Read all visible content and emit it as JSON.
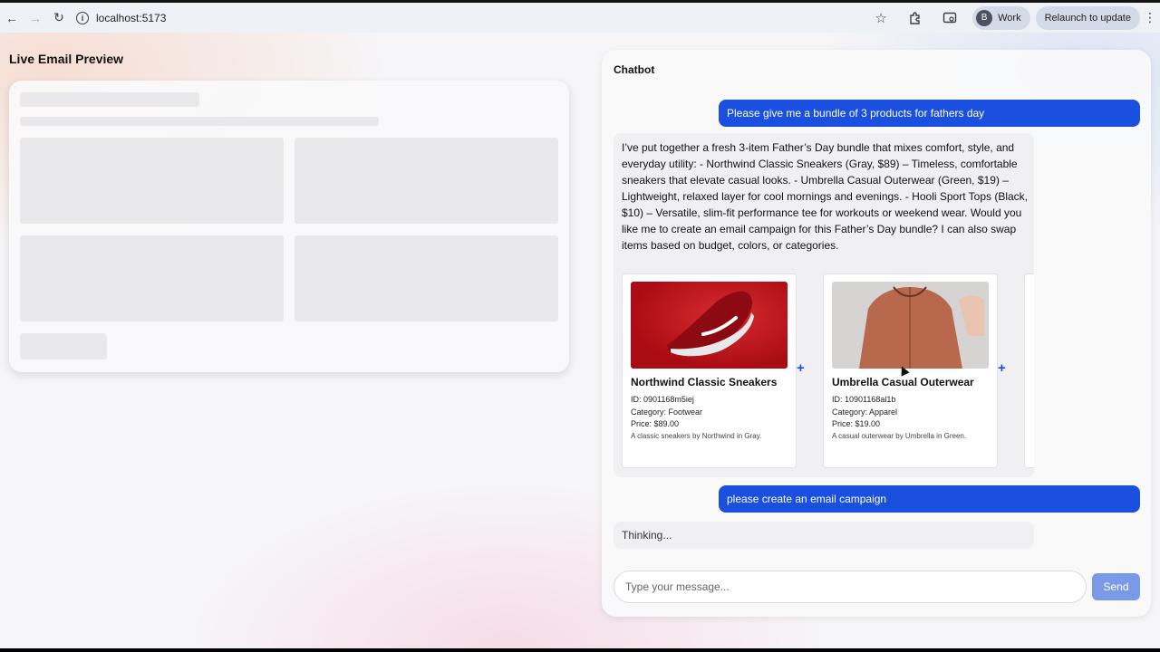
{
  "browser": {
    "back_icon": "←",
    "forward_icon": "→",
    "reload_icon": "↻",
    "url": "localhost:5173",
    "profile_initial": "B",
    "profile_name": "Work",
    "relaunch_label": "Relaunch to update"
  },
  "preview": {
    "title": "Live Email Preview"
  },
  "chat": {
    "title": "Chatbot",
    "messages": [
      {
        "role": "user",
        "text": "Please give me a bundle of 3 products for fathers day"
      },
      {
        "role": "bot",
        "text": "I’ve put together a fresh 3-item Father’s Day bundle that mixes comfort, style, and everyday utility: - Northwind Classic Sneakers (Gray, $89) – Timeless, comfortable sneakers that elevate casual looks. - Umbrella Casual Outerwear (Green, $19) – Lightweight, relaxed layer for cool mornings and evenings. - Hooli Sport Tops (Black, $10) – Versatile, slim-fit performance tee for workouts or weekend wear. Would you like me to create an email campaign for this Father’s Day bundle? I can also swap items based on budget, colors, or categories."
      },
      {
        "role": "user",
        "text": "please create an email campaign"
      }
    ],
    "products": [
      {
        "name": "Northwind Classic Sneakers",
        "id": "ID: 0901168m5iej",
        "category": "Category: Footwear",
        "price": "Price: $89.00",
        "description": "A classic sneakers by Northwind in Gray."
      },
      {
        "name": "Umbrella Casual Outerwear",
        "id": "ID: 10901168al1b",
        "category": "Category: Apparel",
        "price": "Price: $19.00",
        "description": "A casual outerwear by Umbrella in Green."
      }
    ],
    "plus_symbol": "+",
    "thinking": "Thinking...",
    "input_placeholder": "Type your message...",
    "send_label": "Send"
  }
}
